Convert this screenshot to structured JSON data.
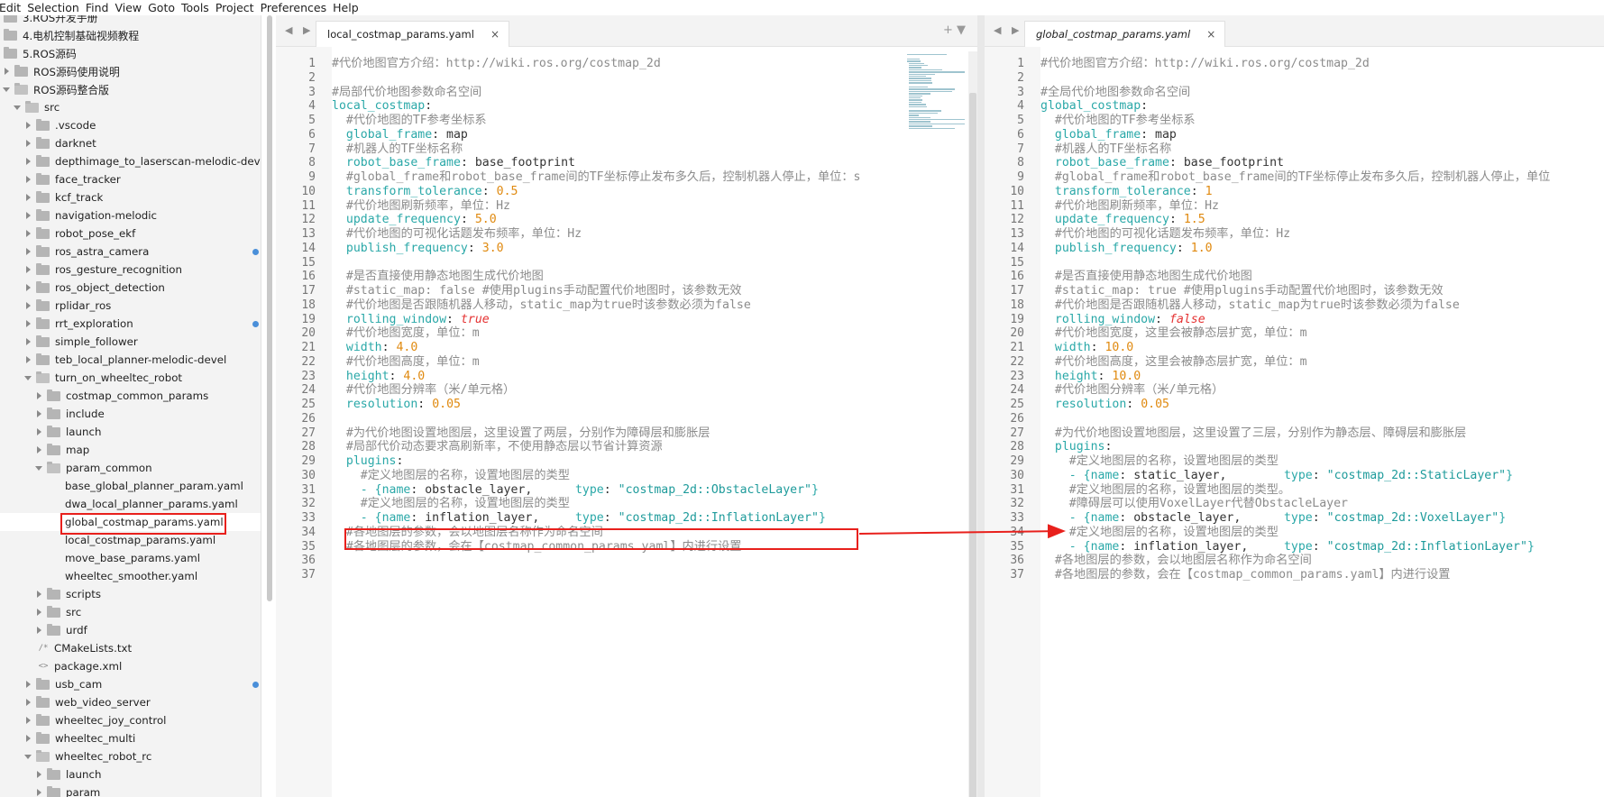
{
  "menu": [
    "Edit",
    "Selection",
    "Find",
    "View",
    "Goto",
    "Tools",
    "Project",
    "Preferences",
    "Help"
  ],
  "sidebar": {
    "items": [
      {
        "label": "3.ROS开发手册",
        "depth": 0,
        "kind": "folder",
        "state": "none"
      },
      {
        "label": "4.电机控制基础视频教程",
        "depth": 0,
        "kind": "folder",
        "state": "none"
      },
      {
        "label": "5.ROS源码",
        "depth": 0,
        "kind": "folder",
        "state": "none"
      },
      {
        "label": "ROS源码使用说明",
        "depth": 1,
        "kind": "folder",
        "state": "closed"
      },
      {
        "label": "ROS源码整合版",
        "depth": 1,
        "kind": "folder",
        "state": "open"
      },
      {
        "label": "src",
        "depth": 2,
        "kind": "folder",
        "state": "open"
      },
      {
        "label": ".vscode",
        "depth": 3,
        "kind": "folder",
        "state": "closed"
      },
      {
        "label": "darknet",
        "depth": 3,
        "kind": "folder",
        "state": "closed"
      },
      {
        "label": "depthimage_to_laserscan-melodic-devel",
        "depth": 3,
        "kind": "folder",
        "state": "closed"
      },
      {
        "label": "face_tracker",
        "depth": 3,
        "kind": "folder",
        "state": "closed"
      },
      {
        "label": "kcf_track",
        "depth": 3,
        "kind": "folder",
        "state": "closed"
      },
      {
        "label": "navigation-melodic",
        "depth": 3,
        "kind": "folder",
        "state": "closed"
      },
      {
        "label": "robot_pose_ekf",
        "depth": 3,
        "kind": "folder",
        "state": "closed"
      },
      {
        "label": "ros_astra_camera",
        "depth": 3,
        "kind": "folder",
        "state": "closed",
        "dot": true
      },
      {
        "label": "ros_gesture_recognition",
        "depth": 3,
        "kind": "folder",
        "state": "closed"
      },
      {
        "label": "ros_object_detection",
        "depth": 3,
        "kind": "folder",
        "state": "closed"
      },
      {
        "label": "rplidar_ros",
        "depth": 3,
        "kind": "folder",
        "state": "closed"
      },
      {
        "label": "rrt_exploration",
        "depth": 3,
        "kind": "folder",
        "state": "closed",
        "dot": true
      },
      {
        "label": "simple_follower",
        "depth": 3,
        "kind": "folder",
        "state": "closed"
      },
      {
        "label": "teb_local_planner-melodic-devel",
        "depth": 3,
        "kind": "folder",
        "state": "closed"
      },
      {
        "label": "turn_on_wheeltec_robot",
        "depth": 3,
        "kind": "folder",
        "state": "open"
      },
      {
        "label": "costmap_common_params",
        "depth": 4,
        "kind": "folder",
        "state": "closed"
      },
      {
        "label": "include",
        "depth": 4,
        "kind": "folder",
        "state": "closed"
      },
      {
        "label": "launch",
        "depth": 4,
        "kind": "folder",
        "state": "closed"
      },
      {
        "label": "map",
        "depth": 4,
        "kind": "folder",
        "state": "closed"
      },
      {
        "label": "param_common",
        "depth": 4,
        "kind": "folder",
        "state": "open"
      },
      {
        "label": "base_global_planner_param.yaml",
        "depth": 5,
        "kind": "file",
        "state": "none"
      },
      {
        "label": "dwa_local_planner_params.yaml",
        "depth": 5,
        "kind": "file",
        "state": "none"
      },
      {
        "label": "global_costmap_params.yaml",
        "depth": 5,
        "kind": "file",
        "state": "none",
        "selected": true
      },
      {
        "label": "local_costmap_params.yaml",
        "depth": 5,
        "kind": "file",
        "state": "none"
      },
      {
        "label": "move_base_params.yaml",
        "depth": 5,
        "kind": "file",
        "state": "none"
      },
      {
        "label": "wheeltec_smoother.yaml",
        "depth": 5,
        "kind": "file",
        "state": "none"
      },
      {
        "label": "scripts",
        "depth": 4,
        "kind": "folder",
        "state": "closed"
      },
      {
        "label": "src",
        "depth": 4,
        "kind": "folder",
        "state": "closed"
      },
      {
        "label": "urdf",
        "depth": 4,
        "kind": "folder",
        "state": "closed"
      },
      {
        "label": "CMakeLists.txt",
        "depth": 4,
        "kind": "file",
        "state": "none",
        "icon": "/*"
      },
      {
        "label": "package.xml",
        "depth": 4,
        "kind": "file",
        "state": "none",
        "icon": "<>"
      },
      {
        "label": "usb_cam",
        "depth": 3,
        "kind": "folder",
        "state": "closed",
        "dot": true
      },
      {
        "label": "web_video_server",
        "depth": 3,
        "kind": "folder",
        "state": "closed"
      },
      {
        "label": "wheeltec_joy_control",
        "depth": 3,
        "kind": "folder",
        "state": "closed"
      },
      {
        "label": "wheeltec_multi",
        "depth": 3,
        "kind": "folder",
        "state": "closed"
      },
      {
        "label": "wheeltec_robot_rc",
        "depth": 3,
        "kind": "folder",
        "state": "open"
      },
      {
        "label": "launch",
        "depth": 4,
        "kind": "folder",
        "state": "closed"
      },
      {
        "label": "param",
        "depth": 4,
        "kind": "folder",
        "state": "closed"
      }
    ]
  },
  "left_pane": {
    "nav": "◀ ▶",
    "tab_label": "local_costmap_params.yaml",
    "tab_close": "×",
    "tools": "+ ▼",
    "lines": [
      [
        [
          "c",
          "#代价地图官方介绍：http://wiki.ros.org/costmap_2d"
        ]
      ],
      [],
      [
        [
          "c",
          "#局部代价地图参数命名空间"
        ]
      ],
      [
        [
          "k",
          "local_costmap"
        ],
        [
          "p",
          ":"
        ]
      ],
      [
        [
          "p",
          "  "
        ],
        [
          "c",
          "#代价地图的TF参考坐标系"
        ]
      ],
      [
        [
          "p",
          "  "
        ],
        [
          "k",
          "global_frame"
        ],
        [
          "p",
          ": map"
        ]
      ],
      [
        [
          "p",
          "  "
        ],
        [
          "c",
          "#机器人的TF坐标名称"
        ]
      ],
      [
        [
          "p",
          "  "
        ],
        [
          "k",
          "robot_base_frame"
        ],
        [
          "p",
          ": base_footprint"
        ]
      ],
      [
        [
          "p",
          "  "
        ],
        [
          "c",
          "#global_frame和robot_base_frame间的TF坐标停止发布多久后，控制机器人停止，单位：s"
        ]
      ],
      [
        [
          "p",
          "  "
        ],
        [
          "k",
          "transform_tolerance"
        ],
        [
          "p",
          ": "
        ],
        [
          "n",
          "0.5"
        ]
      ],
      [
        [
          "p",
          "  "
        ],
        [
          "c",
          "#代价地图刷新频率，单位：Hz"
        ]
      ],
      [
        [
          "p",
          "  "
        ],
        [
          "k",
          "update_frequency"
        ],
        [
          "p",
          ": "
        ],
        [
          "n",
          "5.0"
        ]
      ],
      [
        [
          "p",
          "  "
        ],
        [
          "c",
          "#代价地图的可视化话题发布频率，单位：Hz"
        ]
      ],
      [
        [
          "p",
          "  "
        ],
        [
          "k",
          "publish_frequency"
        ],
        [
          "p",
          ": "
        ],
        [
          "n",
          "3.0"
        ]
      ],
      [],
      [
        [
          "p",
          "  "
        ],
        [
          "c",
          "#是否直接使用静态地图生成代价地图"
        ]
      ],
      [
        [
          "p",
          "  "
        ],
        [
          "c",
          "#static_map: false #使用plugins手动配置代价地图时，该参数无效"
        ]
      ],
      [
        [
          "p",
          "  "
        ],
        [
          "c",
          "#代价地图是否跟随机器人移动，static_map为true时该参数必须为false"
        ]
      ],
      [
        [
          "p",
          "  "
        ],
        [
          "k",
          "rolling_window"
        ],
        [
          "p",
          ": "
        ],
        [
          "b",
          "true"
        ]
      ],
      [
        [
          "p",
          "  "
        ],
        [
          "c",
          "#代价地图宽度，单位：m"
        ]
      ],
      [
        [
          "p",
          "  "
        ],
        [
          "k",
          "width"
        ],
        [
          "p",
          ": "
        ],
        [
          "n",
          "4.0"
        ]
      ],
      [
        [
          "p",
          "  "
        ],
        [
          "c",
          "#代价地图高度，单位：m"
        ]
      ],
      [
        [
          "p",
          "  "
        ],
        [
          "k",
          "height"
        ],
        [
          "p",
          ": "
        ],
        [
          "n",
          "4.0"
        ]
      ],
      [
        [
          "p",
          "  "
        ],
        [
          "c",
          "#代价地图分辨率（米/单元格）"
        ]
      ],
      [
        [
          "p",
          "  "
        ],
        [
          "k",
          "resolution"
        ],
        [
          "p",
          ": "
        ],
        [
          "n",
          "0.05"
        ]
      ],
      [],
      [
        [
          "p",
          "  "
        ],
        [
          "c",
          "#为代价地图设置地图层，这里设置了两层，分别作为障碍层和膨胀层"
        ]
      ],
      [
        [
          "p",
          "  "
        ],
        [
          "c",
          "#局部代价动态要求高刷新率，不使用静态层以节省计算资源"
        ]
      ],
      [
        [
          "p",
          "  "
        ],
        [
          "k",
          "plugins"
        ],
        [
          "p",
          ":"
        ]
      ],
      [
        [
          "p",
          "    "
        ],
        [
          "c",
          "#定义地图层的名称，设置地图层的类型"
        ]
      ],
      [
        [
          "p",
          "    "
        ],
        [
          "k",
          "- {name"
        ],
        [
          "p",
          ": obstacle_layer,      "
        ],
        [
          "k",
          "type"
        ],
        [
          "p",
          ": "
        ],
        [
          "s",
          "\"costmap_2d::ObstacleLayer\""
        ],
        [
          "k",
          "}"
        ]
      ],
      [
        [
          "p",
          "    "
        ],
        [
          "c",
          "#定义地图层的名称，设置地图层的类型"
        ]
      ],
      [
        [
          "p",
          "    "
        ],
        [
          "k",
          "- {name"
        ],
        [
          "p",
          ": inflation_layer,     "
        ],
        [
          "k",
          "type"
        ],
        [
          "p",
          ": "
        ],
        [
          "s",
          "\"costmap_2d::InflationLayer\""
        ],
        [
          "k",
          "}"
        ]
      ],
      [
        [
          "p",
          "  "
        ],
        [
          "c",
          "#各地图层的参数，会以地图层名称作为命名空间"
        ]
      ],
      [
        [
          "p",
          "  "
        ],
        [
          "c",
          "#各地图层的参数，会在【costmap_common_params.yaml】内进行设置"
        ]
      ],
      [],
      []
    ]
  },
  "right_pane": {
    "nav": "◀ ▶",
    "tab_label": "global_costmap_params.yaml",
    "tab_close": "×",
    "lines": [
      [
        [
          "c",
          "#代价地图官方介绍：http://wiki.ros.org/costmap_2d"
        ]
      ],
      [],
      [
        [
          "c",
          "#全局代价地图参数命名空间"
        ]
      ],
      [
        [
          "k",
          "global_costmap"
        ],
        [
          "p",
          ":"
        ]
      ],
      [
        [
          "p",
          "  "
        ],
        [
          "c",
          "#代价地图的TF参考坐标系"
        ]
      ],
      [
        [
          "p",
          "  "
        ],
        [
          "k",
          "global_frame"
        ],
        [
          "p",
          ": map"
        ]
      ],
      [
        [
          "p",
          "  "
        ],
        [
          "c",
          "#机器人的TF坐标名称"
        ]
      ],
      [
        [
          "p",
          "  "
        ],
        [
          "k",
          "robot_base_frame"
        ],
        [
          "p",
          ": base_footprint"
        ]
      ],
      [
        [
          "p",
          "  "
        ],
        [
          "c",
          "#global_frame和robot_base_frame间的TF坐标停止发布多久后，控制机器人停止，单位"
        ]
      ],
      [
        [
          "p",
          "  "
        ],
        [
          "k",
          "transform_tolerance"
        ],
        [
          "p",
          ": "
        ],
        [
          "n",
          "1"
        ]
      ],
      [
        [
          "p",
          "  "
        ],
        [
          "c",
          "#代价地图刷新频率，单位：Hz"
        ]
      ],
      [
        [
          "p",
          "  "
        ],
        [
          "k",
          "update_frequency"
        ],
        [
          "p",
          ": "
        ],
        [
          "n",
          "1.5"
        ]
      ],
      [
        [
          "p",
          "  "
        ],
        [
          "c",
          "#代价地图的可视化话题发布频率，单位：Hz"
        ]
      ],
      [
        [
          "p",
          "  "
        ],
        [
          "k",
          "publish_frequency"
        ],
        [
          "p",
          ": "
        ],
        [
          "n",
          "1.0"
        ]
      ],
      [],
      [
        [
          "p",
          "  "
        ],
        [
          "c",
          "#是否直接使用静态地图生成代价地图"
        ]
      ],
      [
        [
          "p",
          "  "
        ],
        [
          "c",
          "#static_map: true #使用plugins手动配置代价地图时，该参数无效"
        ]
      ],
      [
        [
          "p",
          "  "
        ],
        [
          "c",
          "#代价地图是否跟随机器人移动，static_map为true时该参数必须为false"
        ]
      ],
      [
        [
          "p",
          "  "
        ],
        [
          "k",
          "rolling_window"
        ],
        [
          "p",
          ": "
        ],
        [
          "b",
          "false"
        ]
      ],
      [
        [
          "p",
          "  "
        ],
        [
          "c",
          "#代价地图宽度，这里会被静态层扩宽，单位：m"
        ]
      ],
      [
        [
          "p",
          "  "
        ],
        [
          "k",
          "width"
        ],
        [
          "p",
          ": "
        ],
        [
          "n",
          "10.0"
        ]
      ],
      [
        [
          "p",
          "  "
        ],
        [
          "c",
          "#代价地图高度，这里会被静态层扩宽，单位：m"
        ]
      ],
      [
        [
          "p",
          "  "
        ],
        [
          "k",
          "height"
        ],
        [
          "p",
          ": "
        ],
        [
          "n",
          "10.0"
        ]
      ],
      [
        [
          "p",
          "  "
        ],
        [
          "c",
          "#代价地图分辨率（米/单元格）"
        ]
      ],
      [
        [
          "p",
          "  "
        ],
        [
          "k",
          "resolution"
        ],
        [
          "p",
          ": "
        ],
        [
          "n",
          "0.05"
        ]
      ],
      [],
      [
        [
          "p",
          "  "
        ],
        [
          "c",
          "#为代价地图设置地图层，这里设置了三层，分别作为静态层、障碍层和膨胀层"
        ]
      ],
      [
        [
          "p",
          "  "
        ],
        [
          "k",
          "plugins"
        ],
        [
          "p",
          ":"
        ]
      ],
      [
        [
          "p",
          "    "
        ],
        [
          "c",
          "#定义地图层的名称，设置地图层的类型"
        ]
      ],
      [
        [
          "p",
          "    "
        ],
        [
          "k",
          "- {name"
        ],
        [
          "p",
          ": static_layer,        "
        ],
        [
          "k",
          "type"
        ],
        [
          "p",
          ": "
        ],
        [
          "s",
          "\"costmap_2d::StaticLayer\""
        ],
        [
          "k",
          "}"
        ]
      ],
      [
        [
          "p",
          "    "
        ],
        [
          "c",
          "#定义地图层的名称，设置地图层的类型。"
        ]
      ],
      [
        [
          "p",
          "    "
        ],
        [
          "c",
          "#障碍层可以使用VoxelLayer代替ObstacleLayer"
        ]
      ],
      [
        [
          "p",
          "    "
        ],
        [
          "k",
          "- {name"
        ],
        [
          "p",
          ": obstacle_layer,      "
        ],
        [
          "k",
          "type"
        ],
        [
          "p",
          ": "
        ],
        [
          "s",
          "\"costmap_2d::VoxelLayer\""
        ],
        [
          "k",
          "}"
        ]
      ],
      [
        [
          "p",
          "    "
        ],
        [
          "c",
          "#定义地图层的名称，设置地图层的类型"
        ]
      ],
      [
        [
          "p",
          "    "
        ],
        [
          "k",
          "- {name"
        ],
        [
          "p",
          ": inflation_layer,     "
        ],
        [
          "k",
          "type"
        ],
        [
          "p",
          ": "
        ],
        [
          "s",
          "\"costmap_2d::InflationLayer\""
        ],
        [
          "k",
          "}"
        ]
      ],
      [
        [
          "p",
          "  "
        ],
        [
          "c",
          "#各地图层的参数，会以地图层名称作为命名空间"
        ]
      ],
      [
        [
          "p",
          "  "
        ],
        [
          "c",
          "#各地图层的参数，会在【costmap_common_params.yaml】内进行设置"
        ]
      ]
    ]
  },
  "colors": {
    "comment": "#8c8c8c",
    "key": "#2aa8a8",
    "number": "#e08a10",
    "boolean": "#e53333",
    "annotation": "#e8201c",
    "modified_dot": "#4a8fd9"
  }
}
